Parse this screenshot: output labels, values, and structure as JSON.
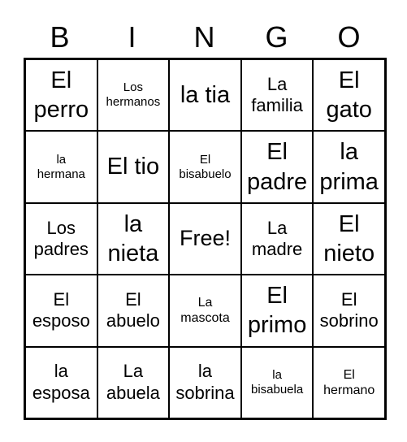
{
  "header": [
    "B",
    "I",
    "N",
    "G",
    "O"
  ],
  "cells": [
    [
      "El perro",
      "Los hermanos",
      "la tia",
      "La familia",
      "El gato"
    ],
    [
      "la hermana",
      "El tio",
      "El bisabuelo",
      "El padre",
      "la prima"
    ],
    [
      "Los padres",
      "la nieta",
      "Free!",
      "La madre",
      "El nieto"
    ],
    [
      "El esposo",
      "El abuelo",
      "La mascota",
      "El primo",
      "El sobrino"
    ],
    [
      "la esposa",
      "La abuela",
      "la sobrina",
      "la bisabuela",
      "El hermano"
    ]
  ]
}
